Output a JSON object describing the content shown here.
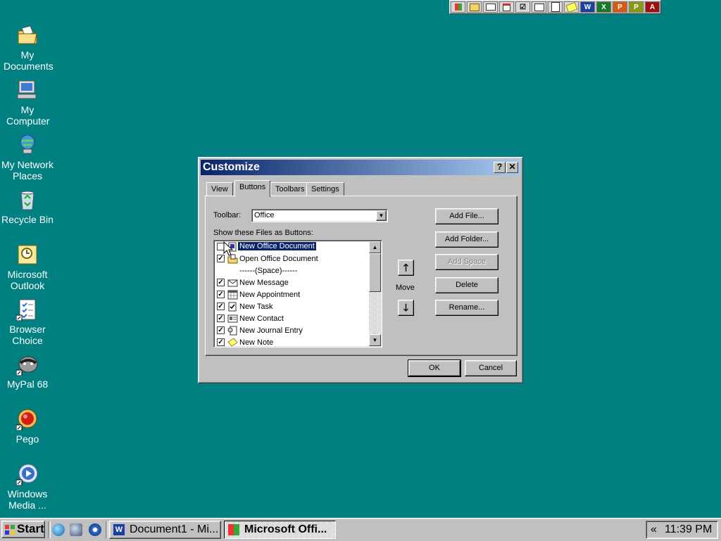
{
  "desktop": {
    "icons": [
      {
        "label": "My Documents"
      },
      {
        "label": "My Computer"
      },
      {
        "label": "My Network Places"
      },
      {
        "label": "Recycle Bin"
      },
      {
        "label": "Microsoft Outlook"
      },
      {
        "label": "Browser Choice"
      },
      {
        "label": "MyPal 68"
      },
      {
        "label": "Pego"
      },
      {
        "label": "Windows Media ..."
      }
    ]
  },
  "office_bar": {
    "buttons": [
      "office-logo-icon",
      "open-folder-icon",
      "new-message-icon",
      "new-appointment-icon",
      "new-task-icon",
      "new-contact-icon",
      "new-journal-icon",
      "new-note-icon",
      "word-icon",
      "excel-icon",
      "powerpoint-icon",
      "publisher-icon",
      "access-icon"
    ],
    "letters": {
      "word": "W",
      "excel": "X",
      "powerpoint": "P",
      "publisher": "P",
      "access": "A"
    }
  },
  "dialog": {
    "title": "Customize",
    "help": "?",
    "close": "✕",
    "tabs": [
      "View",
      "Buttons",
      "Toolbars",
      "Settings"
    ],
    "active_tab": "Buttons",
    "toolbar_label": "Toolbar:",
    "toolbar_value": "Office",
    "list_label": "Show these Files as Buttons:",
    "items": [
      {
        "label": "New Office Document",
        "checked": false,
        "selected": true
      },
      {
        "label": "Open Office Document",
        "checked": true
      },
      {
        "label": "------(Space)------",
        "checked": true
      },
      {
        "label": "New Message",
        "checked": true
      },
      {
        "label": "New Appointment",
        "checked": true
      },
      {
        "label": "New Task",
        "checked": true
      },
      {
        "label": "New Contact",
        "checked": true
      },
      {
        "label": "New Journal Entry",
        "checked": true
      },
      {
        "label": "New Note",
        "checked": true
      }
    ],
    "move_label": "Move",
    "buttons": {
      "add_file": "Add File...",
      "add_folder": "Add Folder...",
      "add_space": "Add Space",
      "delete": "Delete",
      "rename": "Rename...",
      "ok": "OK",
      "cancel": "Cancel"
    }
  },
  "taskbar": {
    "start": "Start",
    "tasks": [
      {
        "label": "Document1 - Mi...",
        "active": false
      },
      {
        "label": "Microsoft Offi...",
        "active": true
      }
    ],
    "tray_chevron": "«",
    "clock": "11:39 PM"
  },
  "colors": {
    "desktop": "#008080",
    "title_start": "#0a246a",
    "title_end": "#a6caf0",
    "selection": "#0a246a"
  }
}
